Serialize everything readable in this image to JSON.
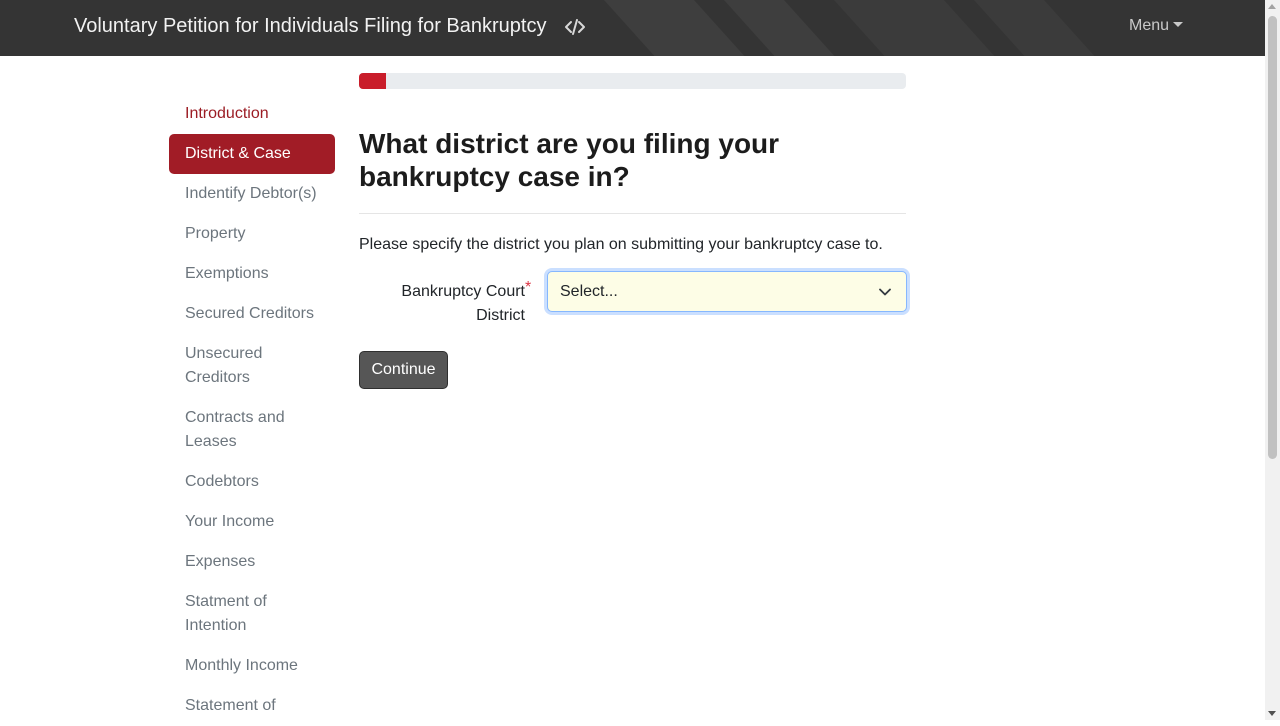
{
  "header": {
    "title": "Voluntary Petition for Individuals Filing for Bankruptcy",
    "code_icon": "code-icon",
    "menu_label": "Menu"
  },
  "progress": {
    "percent": 5,
    "color": "#c91d2a"
  },
  "sidebar": {
    "items": [
      {
        "label": "Introduction",
        "state": "visited"
      },
      {
        "label": "District & Case",
        "state": "active"
      },
      {
        "label": "Indentify Debtor(s)",
        "state": "default"
      },
      {
        "label": "Property",
        "state": "default"
      },
      {
        "label": "Exemptions",
        "state": "default"
      },
      {
        "label": "Secured Creditors",
        "state": "default"
      },
      {
        "label": "Unsecured Creditors",
        "state": "default"
      },
      {
        "label": "Contracts and Leases",
        "state": "default"
      },
      {
        "label": "Codebtors",
        "state": "default"
      },
      {
        "label": "Your Income",
        "state": "default"
      },
      {
        "label": "Expenses",
        "state": "default"
      },
      {
        "label": "Statment of Intention",
        "state": "default"
      },
      {
        "label": "Monthly Income",
        "state": "default"
      },
      {
        "label": "Statement of",
        "state": "default"
      }
    ]
  },
  "main": {
    "title": "What district are you filing your bankruptcy case in?",
    "subtitle": "Please specify the district you plan on submitting your bankruptcy case to.",
    "field": {
      "label": "Bankruptcy Court District",
      "required_marker": "*",
      "value": "Select..."
    },
    "continue_label": "Continue"
  },
  "colors": {
    "navbar": "#343434",
    "accent": "#a11c26",
    "button": "#565656"
  }
}
